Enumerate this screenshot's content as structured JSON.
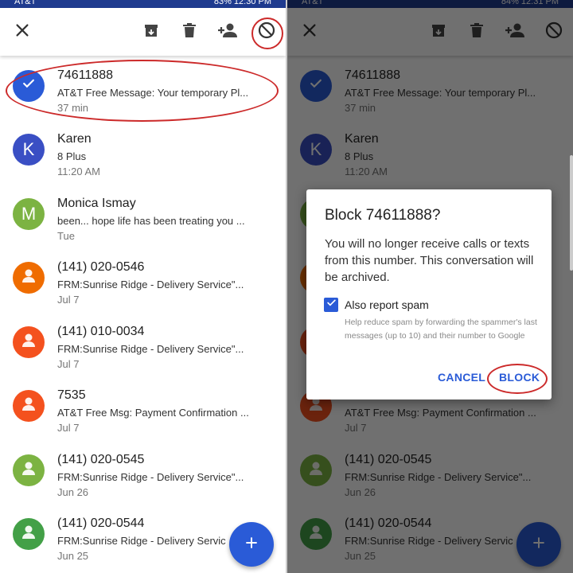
{
  "status_left": {
    "carrier": "AT&T",
    "right": "83% 12:30 PM"
  },
  "status_right": {
    "carrier": "AT&T",
    "right": "84% 12:31 PM"
  },
  "colors": {
    "accent": "#2a5bd7",
    "highlight": "#cc2a2a"
  },
  "toolbar": {
    "icons": [
      "close-icon",
      "archive-icon",
      "delete-icon",
      "add-contact-icon",
      "block-icon"
    ]
  },
  "conversations": [
    {
      "name": "74611888",
      "snippet": "AT&T Free Message: Your temporary Pl...",
      "time": "37 min",
      "avatar_color": "#2a5bd7",
      "avatar_letter": "",
      "selected": true
    },
    {
      "name": "Karen",
      "snippet": "8 Plus",
      "time": "11:20 AM",
      "avatar_color": "#3a4fc4",
      "avatar_letter": "K"
    },
    {
      "name": "Monica Ismay",
      "snippet": "been... hope life has been treating you ...",
      "time": "Tue",
      "avatar_color": "#7cb342",
      "avatar_letter": "M"
    },
    {
      "name": "(141) 020-0546",
      "snippet": "FRM:Sunrise Ridge - Delivery Service\"...",
      "time": "Jul 7",
      "avatar_color": "#ef6c00",
      "avatar_letter": ""
    },
    {
      "name": "(141) 010-0034",
      "snippet": "FRM:Sunrise Ridge - Delivery Service\"...",
      "time": "Jul 7",
      "avatar_color": "#f4511e",
      "avatar_letter": ""
    },
    {
      "name": "7535",
      "snippet": "AT&T Free Msg: Payment Confirmation ...",
      "time": "Jul 7",
      "avatar_color": "#f4511e",
      "avatar_letter": ""
    },
    {
      "name": "(141) 020-0545",
      "snippet": "FRM:Sunrise Ridge - Delivery Service\"...",
      "time": "Jun 26",
      "avatar_color": "#7cb342",
      "avatar_letter": ""
    },
    {
      "name": "(141) 020-0544",
      "snippet": "FRM:Sunrise Ridge - Delivery Servic",
      "time": "Jun 25",
      "avatar_color": "#43a047",
      "avatar_letter": ""
    }
  ],
  "fab": {
    "label": "+"
  },
  "dialog": {
    "title": "Block 74611888?",
    "body": "You will no longer receive calls or texts from this number. This conversation will be archived.",
    "checkbox_label": "Also report spam",
    "checkbox_checked": true,
    "help": "Help reduce spam by forwarding the spammer's last messages (up to 10) and their number to Google",
    "cancel_label": "CANCEL",
    "block_label": "BLOCK"
  }
}
